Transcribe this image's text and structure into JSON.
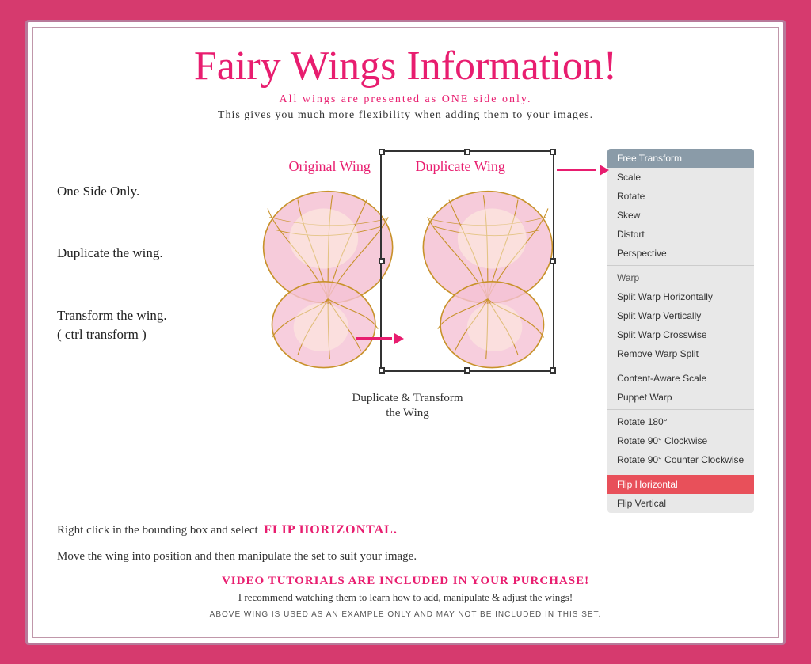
{
  "page": {
    "title": "Fairy Wings Information!",
    "subtitle_pink": "All wings are presented as ONE side only.",
    "subtitle_black": "This gives you much more flexibility when adding them to your images."
  },
  "steps": {
    "step1": "One Side Only.",
    "step2": "Duplicate the wing.",
    "step3": "Transform the wing.\n( ctrl transform )"
  },
  "wing_labels": {
    "original": "Original Wing",
    "duplicate": "Duplicate Wing"
  },
  "caption": {
    "line1": "Duplicate & Transform",
    "line2": "the Wing"
  },
  "instructions": {
    "flip_text_before": "Right click in the bounding box and select",
    "flip_text_highlight": "FLIP HORIZONTAL.",
    "manipulate": "Move the wing into position and then manipulate the set to suit your image.",
    "video_tutorials": "VIDEO TUTORIALS ARE INCLUDED IN YOUR PURCHASE!",
    "recommend": "I recommend watching them to learn how to add, manipulate & adjust the wings!",
    "disclaimer": "ABOVE WING IS USED AS AN EXAMPLE ONLY AND MAY NOT BE INCLUDED IN THIS SET."
  },
  "menu": {
    "items": [
      {
        "label": "Free Transform",
        "type": "selected"
      },
      {
        "label": "Scale",
        "type": "normal"
      },
      {
        "label": "Rotate",
        "type": "normal"
      },
      {
        "label": "Skew",
        "type": "normal"
      },
      {
        "label": "Distort",
        "type": "normal"
      },
      {
        "label": "Perspective",
        "type": "normal"
      },
      {
        "label": "divider",
        "type": "divider"
      },
      {
        "label": "Warp",
        "type": "section-header"
      },
      {
        "label": "Split Warp Horizontally",
        "type": "normal"
      },
      {
        "label": "Split Warp Vertically",
        "type": "normal"
      },
      {
        "label": "Split Warp Crosswise",
        "type": "normal"
      },
      {
        "label": "Remove Warp Split",
        "type": "normal"
      },
      {
        "label": "divider",
        "type": "divider"
      },
      {
        "label": "Content-Aware Scale",
        "type": "normal"
      },
      {
        "label": "Puppet Warp",
        "type": "normal"
      },
      {
        "label": "divider",
        "type": "divider"
      },
      {
        "label": "Rotate 180°",
        "type": "normal"
      },
      {
        "label": "Rotate 90° Clockwise",
        "type": "normal"
      },
      {
        "label": "Rotate 90° Counter Clockwise",
        "type": "normal"
      },
      {
        "label": "divider",
        "type": "divider"
      },
      {
        "label": "Flip Horizontal",
        "type": "highlighted"
      },
      {
        "label": "Flip Vertical",
        "type": "normal"
      }
    ]
  },
  "colors": {
    "pink": "#e81d6f",
    "background": "#d63a6e",
    "menu_selected": "#8a9ba8",
    "menu_highlighted": "#e8505a"
  }
}
